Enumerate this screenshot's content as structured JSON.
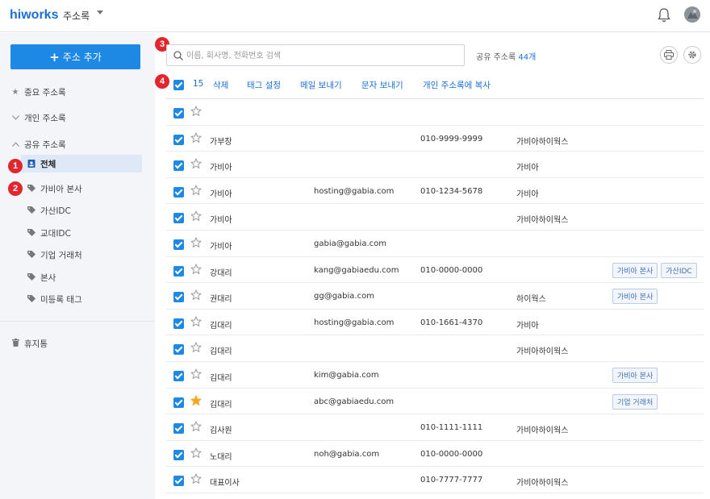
{
  "header": {
    "logo": "hiworks",
    "app_title": "주소록"
  },
  "sidebar": {
    "add_button": "주소 추가",
    "items": [
      {
        "label": "중요 주소록",
        "icon": "star-icon"
      },
      {
        "label": "개인 주소록",
        "icon": "chevron-down-icon"
      },
      {
        "label": "공유 주소록",
        "icon": "chevron-up-icon"
      },
      {
        "label": "전체",
        "icon": "contacts-icon",
        "selected": true
      },
      {
        "label": "가비아 본사",
        "icon": "tag-icon"
      },
      {
        "label": "가산IDC",
        "icon": "tag-icon"
      },
      {
        "label": "교대IDC",
        "icon": "tag-icon"
      },
      {
        "label": "기업 거래처",
        "icon": "tag-icon"
      },
      {
        "label": "본사",
        "icon": "tag-icon"
      },
      {
        "label": "미등록 태그",
        "icon": "tag-icon"
      },
      {
        "label": "휴지통",
        "icon": "trash-icon"
      }
    ]
  },
  "badges": [
    "1",
    "2",
    "3",
    "4"
  ],
  "search": {
    "placeholder": "이름, 회사명, 전화번호 검색",
    "value": ""
  },
  "share_count": {
    "label": "공유 주소록",
    "count": "44개"
  },
  "toolbar": {
    "selected_count": "15",
    "actions": [
      "삭제",
      "태그 설정",
      "메일 보내기",
      "문자 보내기",
      "개인 주소록에 복사"
    ]
  },
  "contacts": [
    {
      "name": "",
      "email": "",
      "phone": "",
      "company": "",
      "starred": false,
      "tags": []
    },
    {
      "name": "가부장",
      "email": "",
      "phone": "010-9999-9999",
      "company": "가비아하이웍스",
      "starred": false,
      "tags": []
    },
    {
      "name": "가비아",
      "email": "",
      "phone": "",
      "company": "가비아",
      "starred": false,
      "tags": []
    },
    {
      "name": "가비아",
      "email": "hosting@gabia.com",
      "phone": "010-1234-5678",
      "company": "가비아",
      "starred": false,
      "tags": []
    },
    {
      "name": "가비아",
      "email": "",
      "phone": "",
      "company": "가비아하이웍스",
      "starred": false,
      "tags": []
    },
    {
      "name": "가비아",
      "email": "gabia@gabia.com",
      "phone": "",
      "company": "",
      "starred": false,
      "tags": []
    },
    {
      "name": "강대리",
      "email": "kang@gabiaedu.com",
      "phone": "010-0000-0000",
      "company": "",
      "starred": false,
      "tags": [
        "가비아 본사",
        "가산IDC"
      ]
    },
    {
      "name": "권대리",
      "email": "gg@gabia.com",
      "phone": "",
      "company": "하이웍스",
      "starred": false,
      "tags": [
        "가비아 본사"
      ]
    },
    {
      "name": "김대리",
      "email": "hosting@gabia.com",
      "phone": "010-1661-4370",
      "company": "가비아",
      "starred": false,
      "tags": []
    },
    {
      "name": "김대리",
      "email": "",
      "phone": "",
      "company": "가비아하이웍스",
      "starred": false,
      "tags": []
    },
    {
      "name": "김대리",
      "email": "kim@gabia.com",
      "phone": "",
      "company": "",
      "starred": false,
      "tags": [
        "가비아 본사"
      ]
    },
    {
      "name": "김대리",
      "email": "abc@gabiaedu.com",
      "phone": "",
      "company": "",
      "starred": true,
      "tags": [
        "기업 거래처"
      ]
    },
    {
      "name": "김사원",
      "email": "",
      "phone": "010-1111-1111",
      "company": "가비아하이웍스",
      "starred": false,
      "tags": []
    },
    {
      "name": "노대리",
      "email": "noh@gabia.com",
      "phone": "010-0000-0000",
      "company": "",
      "starred": false,
      "tags": []
    },
    {
      "name": "대표이사",
      "email": "",
      "phone": "010-7777-7777",
      "company": "가비아하이웍스",
      "starred": false,
      "tags": []
    }
  ],
  "colors": {
    "accent": "#1e88e5",
    "badge": "#e3262d",
    "star_active": "#f5a623"
  }
}
